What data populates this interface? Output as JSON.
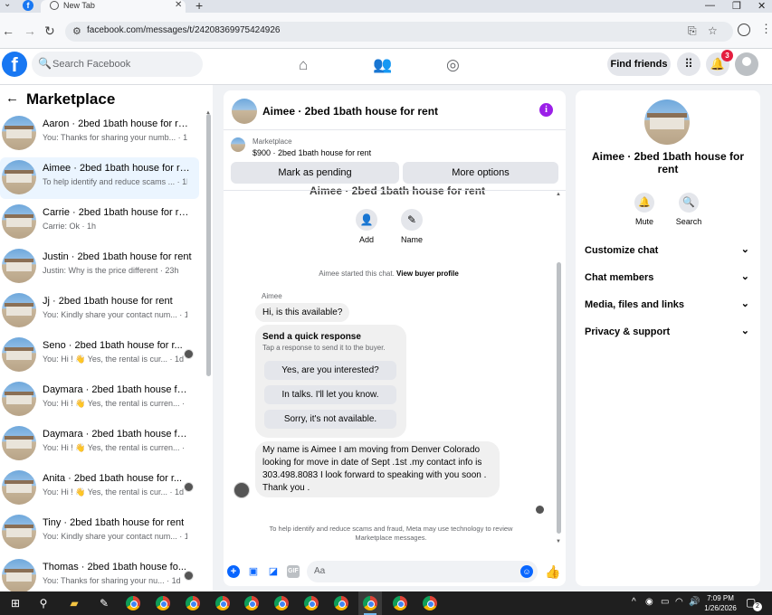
{
  "browser": {
    "tab_title": "New Tab",
    "url": "facebook.com/messages/t/24208369975424926"
  },
  "header": {
    "logo_letter": "f",
    "search_placeholder": "Search Facebook",
    "find_friends": "Find friends",
    "notification_count": "3"
  },
  "sidebar": {
    "title": "Marketplace",
    "conversations": [
      {
        "title": "Aaron · 2bed 1bath house for rent",
        "preview": "You: Thanks for sharing your numb... · 1m"
      },
      {
        "title": "Aimee · 2bed 1bath house for rent",
        "preview": "To help identify and reduce scams ... · 1h"
      },
      {
        "title": "Carrie · 2bed 1bath house for rent",
        "preview": "Carrie: Ok · 1h"
      },
      {
        "title": "Justin · 2bed 1bath house for rent",
        "preview": "Justin: Why is the price different · 23h"
      },
      {
        "title": "Jj · 2bed 1bath house for rent",
        "preview": "You: Kindly share your contact num... · 1d"
      },
      {
        "title": "Seno · 2bed 1bath house for r...",
        "preview": "You: Hi ! 👋 Yes, the rental is cur... · 1d"
      },
      {
        "title": "Daymara · 2bed 1bath house for...",
        "preview": "You: Hi ! 👋 Yes, the rental is curren... · 1d"
      },
      {
        "title": "Daymara · 2bed 1bath house for...",
        "preview": "You: Hi ! 👋 Yes, the rental is curren... · 1d"
      },
      {
        "title": "Anita · 2bed 1bath house for r...",
        "preview": "You: Hi ! 👋 Yes, the rental is cur... · 1d"
      },
      {
        "title": "Tiny · 2bed 1bath house for rent",
        "preview": "You: Kindly share your contact num... · 1d"
      },
      {
        "title": "Thomas · 2bed 1bath house fo...",
        "preview": "You: Thanks for sharing your nu... · 1d"
      }
    ]
  },
  "chat": {
    "title": "Aimee · 2bed 1bath house for rent",
    "marketplace_label": "Marketplace",
    "listing": "$900 · 2bed 1bath house for rent",
    "mark_pending": "Mark as pending",
    "more_options": "More options",
    "cut_title": "Aimee · 2bed 1bath house for rent",
    "add_label": "Add",
    "name_label": "Name",
    "started_text": "Aimee started this chat.",
    "buyer_profile": "View buyer profile",
    "sender_name": "Aimee",
    "first_message": "Hi, is this available?",
    "quick_response_title": "Send a quick response",
    "quick_response_sub": "Tap a response to send it to the buyer.",
    "quick_responses": [
      "Yes, are you interested?",
      "In talks. I'll let you know.",
      "Sorry, it's not available."
    ],
    "long_message": "My name is Aimee I am moving from Denver Colorado looking for move in date of Sept .1st .my contact info is 303.498.8083 I look forward to speaking with you soon . Thank you .",
    "disclaimer": "To help identify and reduce scams and fraud, Meta may use technology to review Marketplace messages.",
    "input_placeholder": "Aa",
    "gif_label": "GIF"
  },
  "details": {
    "title": "Aimee · 2bed 1bath house for rent",
    "mute": "Mute",
    "search": "Search",
    "menu": [
      "Customize chat",
      "Chat members",
      "Media, files and links",
      "Privacy & support"
    ]
  },
  "taskbar": {
    "time": "7:09 PM",
    "date": "1/26/2026",
    "notification_count": "2"
  },
  "colors": {
    "brand": "#1877f2",
    "messenger_blue": "#0866ff",
    "info_purple": "#9b1fe8",
    "badge_red": "#e41e3f"
  }
}
